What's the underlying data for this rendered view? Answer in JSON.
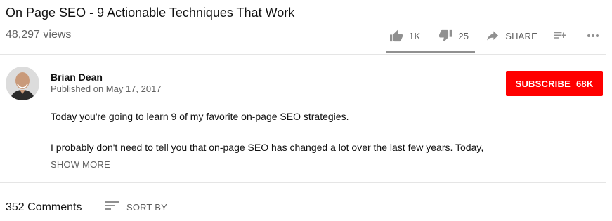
{
  "video": {
    "title": "On Page SEO - 9 Actionable Techniques That Work",
    "views": "48,297 views"
  },
  "actions": {
    "like_icon": "thumbs-up-icon",
    "like_count": "1K",
    "dislike_icon": "thumbs-down-icon",
    "dislike_count": "25",
    "share_icon": "share-arrow-icon",
    "share_label": "SHARE",
    "save_icon": "add-to-playlist-icon",
    "more_icon": "more-horizontal-icon"
  },
  "channel": {
    "name": "Brian Dean",
    "published": "Published on May 17, 2017",
    "avatar_icon": "channel-avatar"
  },
  "subscribe": {
    "label": "SUBSCRIBE",
    "count": "68K",
    "color": "#ff0000"
  },
  "description": {
    "line1": "Today you're going to learn 9 of my favorite on-page SEO strategies.",
    "line2": "I probably don't need to tell you that on-page SEO has changed a lot over the last few years. Today,",
    "show_more": "SHOW MORE"
  },
  "comments": {
    "count_label": "352 Comments",
    "sort_icon": "sort-icon",
    "sort_label": "SORT BY"
  },
  "colors": {
    "text_primary": "#111111",
    "text_secondary": "#606060",
    "divider": "#e5e5e5",
    "icon": "#909090"
  }
}
